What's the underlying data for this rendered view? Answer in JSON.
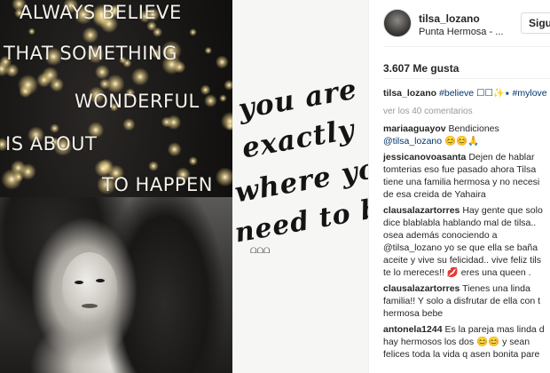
{
  "post": {
    "quote_lines": [
      "ALWAYS BELIEVE",
      "THAT SOMETHING",
      "WONDERFUL",
      "IS ABOUT",
      "TO HAPPEN"
    ],
    "handwritten_lines": [
      "you are",
      "exactly",
      "where you",
      "need to be"
    ],
    "signature": "ᗝᗝᗝ"
  },
  "header": {
    "username": "tilsa_lozano",
    "location": "Punta Hermosa - ...",
    "follow_label": "Siguie",
    "avatar_icon": "user-avatar"
  },
  "likes": "3.607 Me gusta",
  "caption": {
    "user": "tilsa_lozano",
    "text": "#believe ☐☐✨⭑ #mylove"
  },
  "view_all_comments": "ver los 40 comentarios",
  "comments": [
    {
      "user": "mariaaguayov",
      "lines": [
        "Bendiciones",
        "@tilsa_lozano 😊😊🙏"
      ]
    },
    {
      "user": "jessicanovoasanta",
      "lines": [
        "Dejen de hablar",
        "tomterias eso fue pasado ahora Tilsa",
        "tiene una familia hermosa y no necesi",
        "de esa creida de Yahaira"
      ]
    },
    {
      "user": "clausalazartorres",
      "lines": [
        "Hay gente que solo",
        "dice blablabla hablando mal de tilsa..",
        "osea además conociendo a",
        "@tilsa_lozano yo se que ella se baña",
        "aceite y vive su felicidad.. vive feliz tils",
        "te lo mereces!! 💋 eres una queen ."
      ]
    },
    {
      "user": "clausalazartorres",
      "lines": [
        "Tienes una linda",
        "familia!! Y solo a disfrutar de ella con t",
        "hermosa bebe"
      ]
    },
    {
      "user": "antonela1244",
      "lines": [
        "Es la pareja mas linda d",
        "hay hermosos los dos 😊😊 y sean",
        "felices toda la vida q asen bonita pare"
      ]
    }
  ],
  "colors": {
    "link": "#003569",
    "muted": "#999999",
    "text": "#262626",
    "border": "#efefef"
  }
}
